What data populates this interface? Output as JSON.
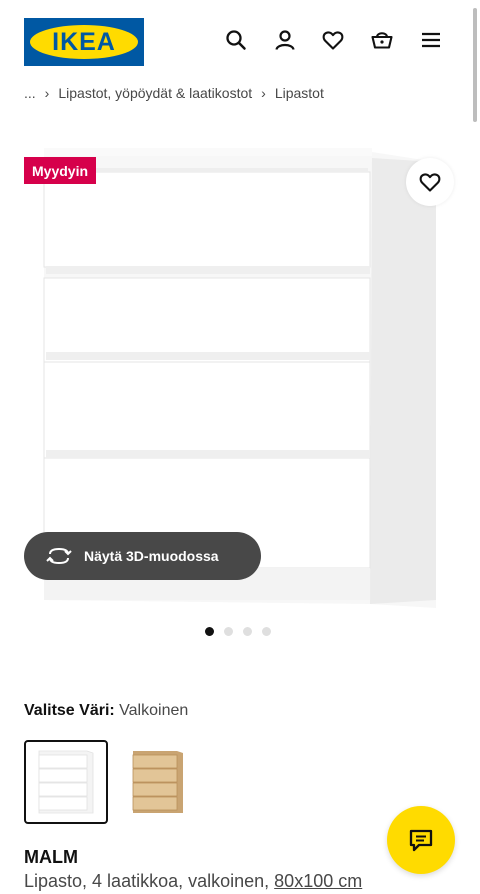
{
  "header": {
    "logo_text": "IKEA",
    "icons": [
      "search-icon",
      "account-icon",
      "heart-icon",
      "basket-icon",
      "menu-icon"
    ]
  },
  "breadcrumb": {
    "ellipsis": "...",
    "items": [
      "Lipastot, yöpöydät & laatikostot",
      "Lipastot"
    ]
  },
  "product_image": {
    "badge": "Myydyin",
    "view_3d_label": "Näytä 3D-muodossa",
    "image_count": 4,
    "active_index": 0
  },
  "color": {
    "label": "Valitse Väri:",
    "value": "Valkoinen",
    "swatches": [
      {
        "name": "white",
        "selected": true,
        "color": "#ffffff"
      },
      {
        "name": "oak",
        "selected": false,
        "color": "#d9b98a"
      }
    ]
  },
  "product": {
    "name": "MALM",
    "description": "Lipasto, 4 laatikkoa, valkoinen,",
    "size": "80x100 cm"
  },
  "colors": {
    "brand_blue": "#0058a3",
    "brand_yellow": "#ffdb00",
    "badge_red": "#d6004b",
    "button_dark": "#484848"
  }
}
